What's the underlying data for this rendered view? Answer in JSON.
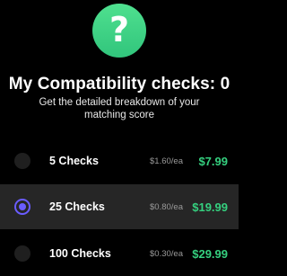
{
  "header": {
    "icon": "question-mark-icon",
    "icon_glyph": "?",
    "title": "My Compatibility checks: 0",
    "subtitle_line1": "Get the detailed breakdown of your",
    "subtitle_line2": "matching score"
  },
  "colors": {
    "accent_green": "#35d07f",
    "radio_selected": "#6a5cff",
    "selected_row_bg": "#262626"
  },
  "options": [
    {
      "label": "5 Checks",
      "unit_price": "$1.60/ea",
      "price": "$7.99",
      "selected": false
    },
    {
      "label": "25 Checks",
      "unit_price": "$0.80/ea",
      "price": "$19.99",
      "selected": true
    },
    {
      "label": "100 Checks",
      "unit_price": "$0.30/ea",
      "price": "$29.99",
      "selected": false
    }
  ]
}
